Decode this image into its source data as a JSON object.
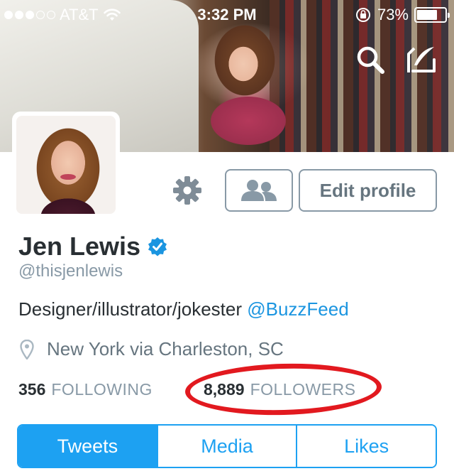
{
  "status_bar": {
    "carrier": "AT&T",
    "time": "3:32 PM",
    "battery": "73%",
    "battery_level": 0.73
  },
  "header": {
    "search_icon": "search-icon",
    "compose_icon": "compose-tweet-icon"
  },
  "actions": {
    "settings_icon": "gear-icon",
    "people_icon": "people-icon",
    "edit_profile_label": "Edit profile"
  },
  "profile": {
    "name": "Jen Lewis",
    "verified": true,
    "handle": "@thisjenlewis",
    "bio_text": "Designer/illustrator/jokester ",
    "bio_mention": "@BuzzFeed",
    "location": "New York via Charleston, SC"
  },
  "stats": {
    "following_count": "356",
    "following_label": "FOLLOWING",
    "followers_count": "8,889",
    "followers_label": "FOLLOWERS"
  },
  "tabs": [
    {
      "label": "Tweets",
      "active": true
    },
    {
      "label": "Media",
      "active": false
    },
    {
      "label": "Likes",
      "active": false
    }
  ],
  "colors": {
    "twitter_blue": "#1da1f2",
    "verified_blue": "#1b95e0",
    "annotation_red": "#e2191f",
    "muted_gray": "#8899a6"
  }
}
